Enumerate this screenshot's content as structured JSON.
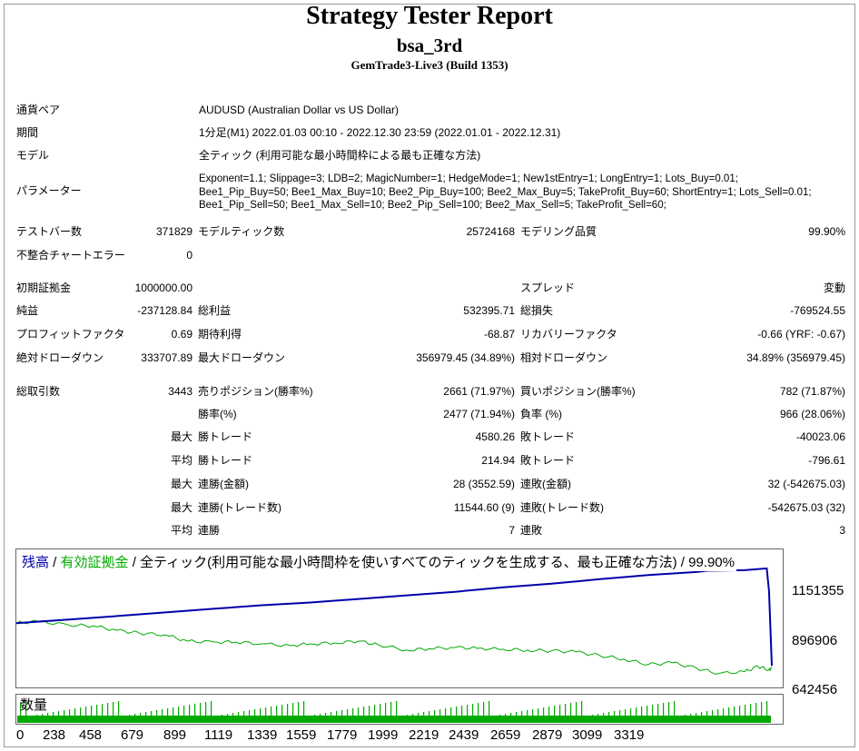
{
  "header": {
    "title": "Strategy Tester Report",
    "ea_name": "bsa_3rd",
    "server": "GemTrade3-Live3 (Build 1353)"
  },
  "info": {
    "symbol_label": "通貨ペア",
    "symbol_value": "AUDUSD (Australian Dollar vs US Dollar)",
    "period_label": "期間",
    "period_value": "1分足(M1) 2022.01.03 00:10 - 2022.12.30 23:59 (2022.01.01 - 2022.12.31)",
    "model_label": "モデル",
    "model_value": "全ティック (利用可能な最小時間枠による最も正確な方法)",
    "params_label": "パラメーター",
    "params_lines": [
      "Exponent=1.1; Slippage=3; LDB=2; MagicNumber=1; HedgeMode=1; New1stEntry=1; LongEntry=1; Lots_Buy=0.01;",
      "Bee1_Pip_Buy=50; Bee1_Max_Buy=10; Bee2_Pip_Buy=100; Bee2_Max_Buy=5; TakeProfit_Buy=60; ShortEntry=1; Lots_Sell=0.01;",
      "Bee1_Pip_Sell=50; Bee1_Max_Sell=10; Bee2_Pip_Sell=100; Bee2_Max_Sell=5; TakeProfit_Sell=60;"
    ]
  },
  "stats": {
    "bars_label": "テストバー数",
    "bars_value": "371829",
    "ticks_label": "モデルティック数",
    "ticks_value": "25724168",
    "quality_label": "モデリング品質",
    "quality_value": "99.90%",
    "errors_label": "不整合チャートエラー",
    "errors_value": "0",
    "deposit_label": "初期証拠金",
    "deposit_value": "1000000.00",
    "spread_label": "スプレッド",
    "spread_value": "変動",
    "net_label": "純益",
    "net_value": "-237128.84",
    "gross_profit_label": "総利益",
    "gross_profit_value": "532395.71",
    "gross_loss_label": "総損失",
    "gross_loss_value": "-769524.55",
    "pf_label": "プロフィットファクタ",
    "pf_value": "0.69",
    "payoff_label": "期待利得",
    "payoff_value": "-68.87",
    "recovery_label": "リカバリーファクタ",
    "recovery_value": "-0.66 (YRF: -0.67)",
    "abs_dd_label": "絶対ドローダウン",
    "abs_dd_value": "333707.89",
    "max_dd_label": "最大ドローダウン",
    "max_dd_value": "356979.45 (34.89%)",
    "rel_dd_label": "相対ドローダウン",
    "rel_dd_value": "34.89% (356979.45)",
    "trades_label": "総取引数",
    "trades_value": "3443",
    "short_label": "売りポジション(勝率%)",
    "short_value": "2661 (71.97%)",
    "long_label": "買いポジション(勝率%)",
    "long_value": "782 (71.87%)",
    "winrate_label": "勝率(%)",
    "winrate_value": "2477 (71.94%)",
    "lossrate_label": "負率 (%)",
    "lossrate_value": "966 (28.06%)",
    "max_label": "最大",
    "avg_label": "平均",
    "max_win_label": "勝トレード",
    "max_win_value": "4580.26",
    "max_loss_label": "敗トレード",
    "max_loss_value": "-40023.06",
    "avg_win_label": "勝トレード",
    "avg_win_value": "214.94",
    "avg_loss_label": "敗トレード",
    "avg_loss_value": "-796.61",
    "cons_wins_money_label": "連勝(金額)",
    "cons_wins_money_value": "28 (3552.59)",
    "cons_loss_money_label": "連敗(金額)",
    "cons_loss_money_value": "32 (-542675.03)",
    "cons_wins_trades_label": "連勝(トレード数)",
    "cons_wins_trades_value": "11544.60 (9)",
    "cons_loss_trades_label": "連敗(トレード数)",
    "cons_loss_trades_value": "-542675.03 (32)",
    "avg_cons_wins_label": "連勝",
    "avg_cons_wins_value": "7",
    "avg_cons_loss_label": "連敗",
    "avg_cons_loss_value": "3"
  },
  "chart_data": {
    "type": "line",
    "legend_balance": "残高",
    "legend_equity": "有効証拠金",
    "legend_sep1": " / ",
    "legend_sep2": " / 全ティック(利用可能な最小時間枠を使いすべてのティックを生成する、最も正確な方法) / 99.90%",
    "volume_label": "数量",
    "y_ticks": [
      "1151355",
      "896906",
      "642456"
    ],
    "x_ticks": [
      "0",
      "238",
      "458",
      "679",
      "899",
      "1119",
      "1339",
      "1559",
      "1779",
      "1999",
      "2219",
      "2439",
      "2659",
      "2879",
      "3099",
      "3319"
    ],
    "ylim": [
      642456,
      1405805
    ],
    "xlim": [
      0,
      3443
    ],
    "colors": {
      "balance": "#0000aa",
      "equity": "#00aa00",
      "volume": "#00aa00"
    },
    "series": [
      {
        "name": "残高",
        "x": [
          0,
          238,
          458,
          679,
          899,
          1119,
          1339,
          1559,
          1779,
          1999,
          2219,
          2439,
          2659,
          2879,
          3099,
          3150,
          3319,
          3420,
          3430,
          3443
        ],
        "values": [
          1000000,
          1020000,
          1040000,
          1060000,
          1080000,
          1100000,
          1115000,
          1135000,
          1155000,
          1175000,
          1200000,
          1220000,
          1245000,
          1268000,
          1285000,
          1292000,
          1295000,
          1305000,
          1180000,
          762871
        ]
      },
      {
        "name": "有効証拠金",
        "x": [
          0,
          100,
          238,
          350,
          458,
          560,
          679,
          780,
          899,
          1000,
          1119,
          1250,
          1339,
          1450,
          1559,
          1650,
          1779,
          1880,
          1999,
          2100,
          2219,
          2330,
          2439,
          2550,
          2659,
          2770,
          2879,
          2990,
          3099,
          3200,
          3319,
          3380,
          3430,
          3443
        ],
        "values": [
          1000000,
          1010000,
          990000,
          985000,
          960000,
          945000,
          935000,
          900000,
          895000,
          895000,
          885000,
          875000,
          885000,
          890000,
          900000,
          880000,
          850000,
          858000,
          865000,
          860000,
          855000,
          850000,
          846000,
          840000,
          820000,
          800000,
          770000,
          780000,
          750000,
          720000,
          730000,
          760000,
          740000,
          750000
        ]
      }
    ]
  }
}
